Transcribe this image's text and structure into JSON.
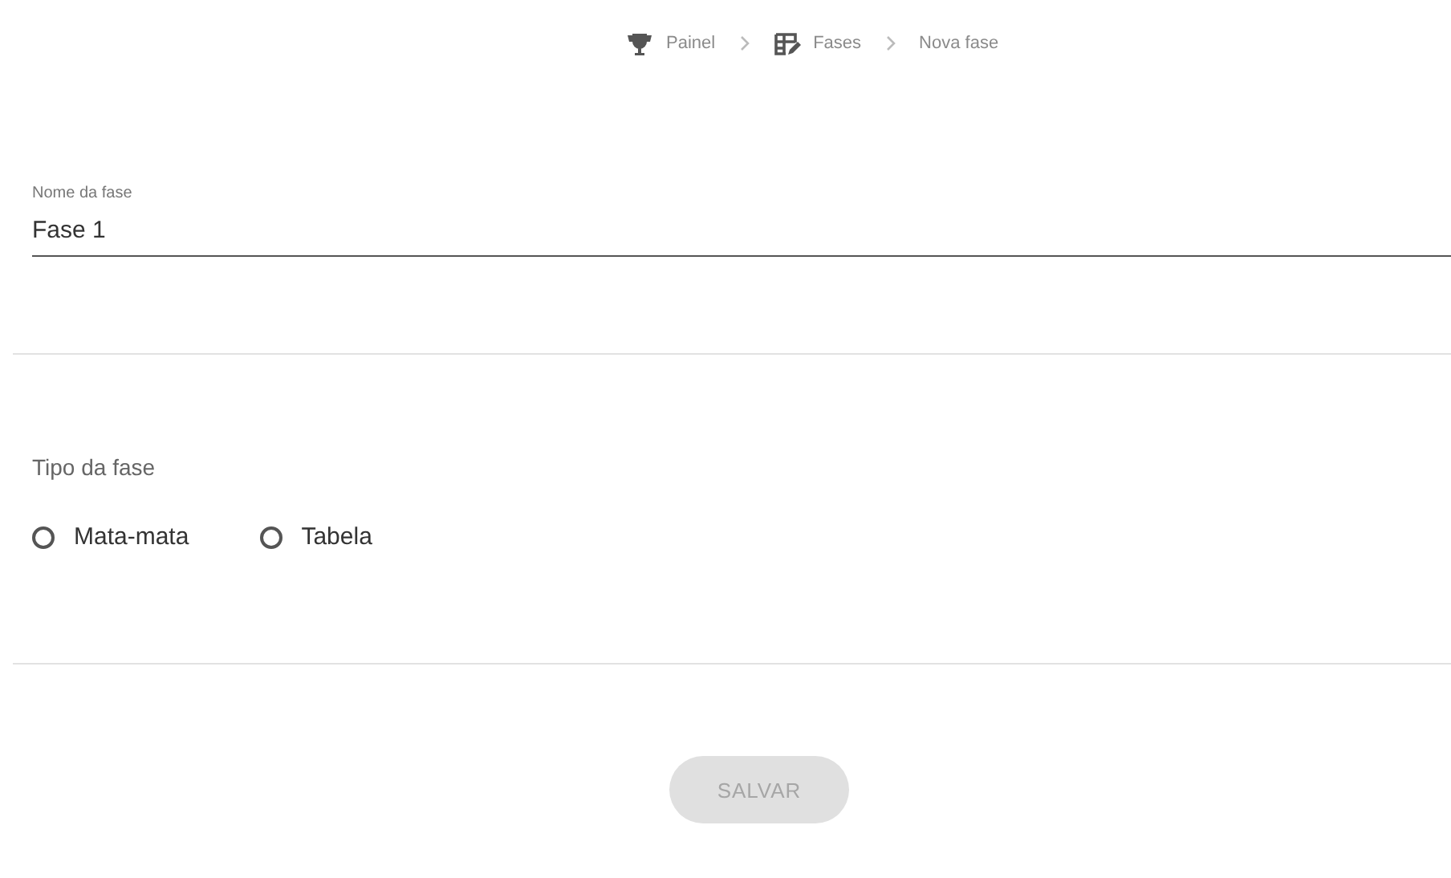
{
  "breadcrumb": [
    {
      "label": "Painel",
      "kind": "trophy"
    },
    {
      "label": "Fases",
      "kind": "table"
    },
    {
      "label": "Nova fase",
      "kind": "current"
    }
  ],
  "name_field": {
    "label": "Nome da fase",
    "value": "Fase 1"
  },
  "phase_type": {
    "label": "Tipo da fase",
    "options": [
      {
        "label": "Mata-mata",
        "selected": false
      },
      {
        "label": "Tabela",
        "selected": false
      }
    ]
  },
  "save_button": {
    "label": "SALVAR",
    "disabled": true
  }
}
